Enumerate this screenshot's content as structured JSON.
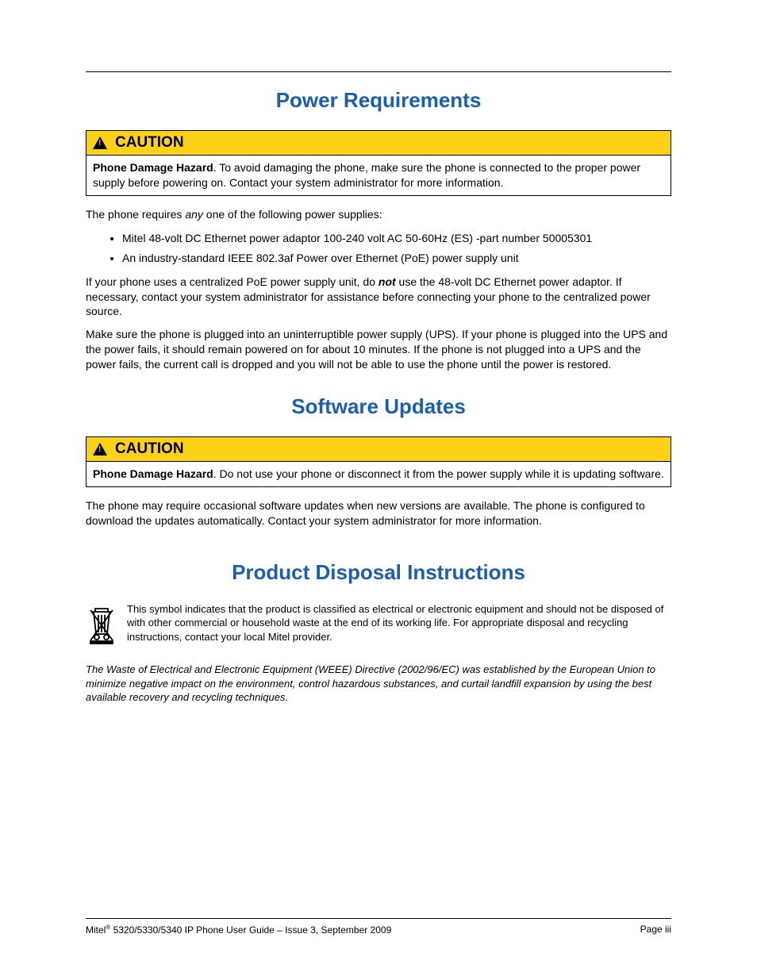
{
  "section1": {
    "title": "Power Requirements",
    "caution_label": "CAUTION",
    "caution_body_bold": "Phone Damage Hazard",
    "caution_body_rest": ". To avoid damaging the phone, make sure the phone is connected to the proper power supply before powering on. Contact your system administrator for more information.",
    "p1_a": "The phone requires ",
    "p1_em": "any",
    "p1_b": " one of the following power supplies:",
    "bullets": [
      "Mitel 48-volt DC Ethernet power adaptor 100-240 volt AC 50-60Hz (ES) -part number 50005301",
      "An industry-standard IEEE 802.3af Power over Ethernet (PoE) power supply unit"
    ],
    "p2_a": "If your phone uses a centralized PoE power supply unit, do ",
    "p2_em": "not",
    "p2_b": " use the 48-volt DC Ethernet power adaptor. If necessary, contact your system administrator for assistance before connecting your phone to the centralized power source.",
    "p3": "Make sure the phone is plugged into an uninterruptible power supply (UPS). If your phone is plugged into the UPS and the power fails, it should remain powered on for about 10 minutes. If the phone is not plugged into a UPS and the power fails, the current call is dropped and you will not be able to use the phone until the power is restored."
  },
  "section2": {
    "title": "Software Updates",
    "caution_label": "CAUTION",
    "caution_body_bold": "Phone Damage Hazard",
    "caution_body_rest": ". Do not use your phone or disconnect it from the power supply while it is updating software.",
    "p1": "The phone may require occasional software updates when new versions are available. The phone is configured to download the updates automatically. Contact your system administrator for more information."
  },
  "section3": {
    "title": "Product Disposal Instructions",
    "p1": "This symbol indicates that the product is classified as electrical or electronic equipment and should not be disposed of with other commercial or household waste at the end of its working life. For appropriate disposal and recycling instructions, contact your local Mitel provider.",
    "p2": "The Waste of Electrical and Electronic Equipment (WEEE) Directive (2002/96/EC) was established by the European Union to minimize negative impact on the environment, control hazardous substances, and curtail landfill expansion by using the best available recovery and recycling techniques."
  },
  "footer": {
    "left_a": "Mitel",
    "left_sup": "®",
    "left_b": " 5320/5330/5340 IP Phone User Guide  – Issue 3, September 2009",
    "right": "Page iii"
  }
}
